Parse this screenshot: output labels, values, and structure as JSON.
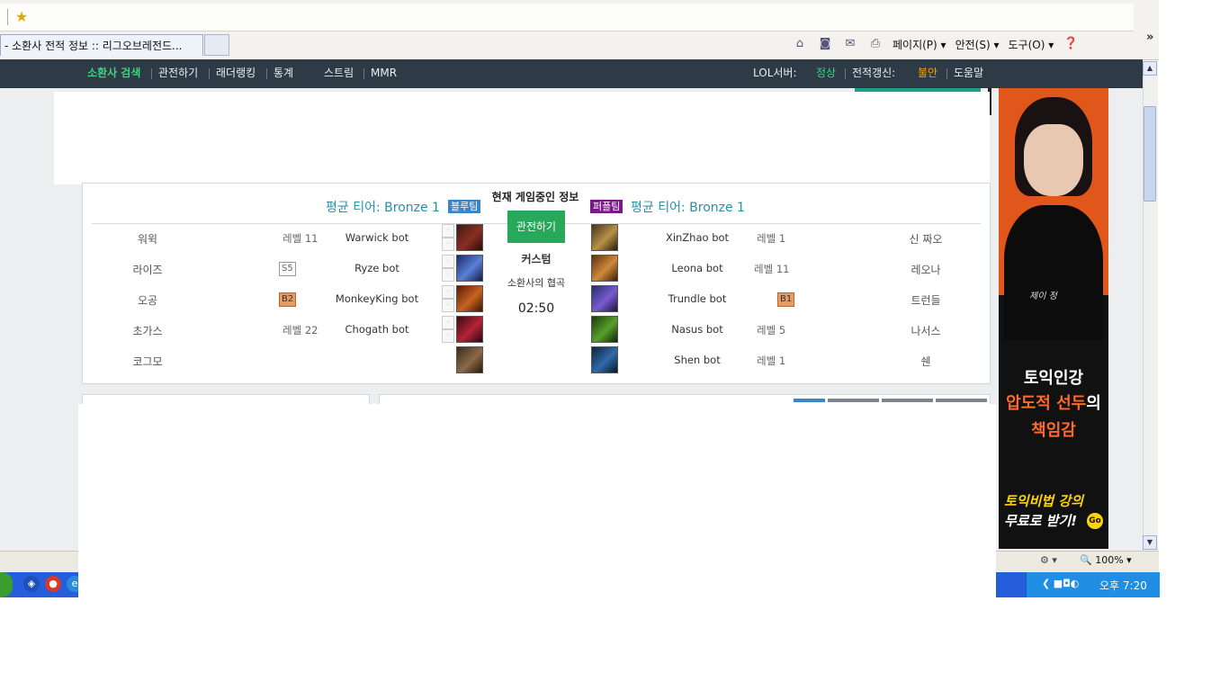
{
  "browser": {
    "tab_title": "- 소환사 전적 정보 :: 리그오브레전드...",
    "toolbar": {
      "page": "페이지(P)",
      "safety": "안전(S)",
      "tools": "도구(O)",
      "more": "»",
      "icons": [
        "home-icon",
        "rss-icon",
        "mail-icon",
        "print-icon",
        "help-icon"
      ]
    },
    "zoom": "100%"
  },
  "site_nav": {
    "items": [
      "소환사 검색",
      "관전하기",
      "래더랭킹",
      "통계",
      "스트림",
      "MMR"
    ],
    "server_label": "LOL서버:",
    "server_status": "정상",
    "refresh_label": "전적갱신:",
    "refresh_status": "불안",
    "help": "도움말",
    "colors": {
      "active": "#3fd17e",
      "ok": "#3fd17e",
      "warn": "#f0a400"
    }
  },
  "game": {
    "title": "현재 게임중인 정보",
    "blue_tier": "평균 티어: Bronze 1",
    "blue_badge": "블루팀",
    "purple_badge": "퍼플팀",
    "purple_tier": "평균 티어: Bronze 1",
    "spectate": "관전하기",
    "mode": "커스텀",
    "map": "소환사의 협곡",
    "timer": "02:50",
    "blue": [
      {
        "name": "워윅",
        "rank": "레벨 11",
        "champion": "Warwick bot"
      },
      {
        "name": "라이즈",
        "rank": "S5",
        "champion": "Ryze bot"
      },
      {
        "name": "오공",
        "rank": "B2",
        "champion": "MonkeyKing bot"
      },
      {
        "name": "초가스",
        "rank": "레벨 22",
        "champion": "Chogath bot"
      },
      {
        "name": "코그모",
        "rank": "",
        "champion": ""
      }
    ],
    "purple": [
      {
        "name": "신 짜오",
        "rank": "레벨 1",
        "champion": "XinZhao bot"
      },
      {
        "name": "레오나",
        "rank": "레벨 11",
        "champion": "Leona bot"
      },
      {
        "name": "트런들",
        "rank": "B1",
        "champion": "Trundle bot"
      },
      {
        "name": "나서스",
        "rank": "레벨 5",
        "champion": "Nasus bot"
      },
      {
        "name": "쉔",
        "rank": "레벨 1",
        "champion": "Shen bot"
      }
    ]
  },
  "side_ad": {
    "signature": "제이 정",
    "line1": "토익인강",
    "line2_highlight": "압도적 선두",
    "line2_rest": "의",
    "line3": "책임감",
    "line4": "토익비법 강의",
    "line5": "무료로 받기!",
    "go": "Go"
  },
  "taskbar": {
    "clock": "오후 7:20"
  }
}
